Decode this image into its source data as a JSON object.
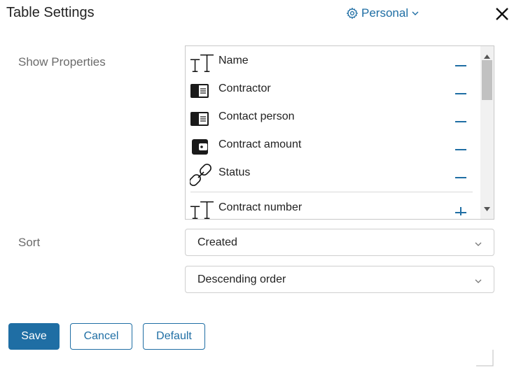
{
  "dialog": {
    "title": "Table Settings",
    "personal_label": "Personal",
    "colors": {
      "accent": "#1f6ea4",
      "label_gray": "#6b6b6b"
    }
  },
  "show_properties": {
    "label": "Show Properties",
    "items": [
      {
        "label": "Name",
        "icon": "text-type-icon",
        "action": "remove"
      },
      {
        "label": "Contractor",
        "icon": "contact-card-icon",
        "action": "remove"
      },
      {
        "label": "Contact person",
        "icon": "contact-card-icon",
        "action": "remove"
      },
      {
        "label": "Contract amount",
        "icon": "wallet-icon",
        "action": "remove"
      },
      {
        "label": "Status",
        "icon": "link-icon",
        "action": "remove"
      },
      {
        "label": "Contract number",
        "icon": "text-type-icon",
        "action": "add"
      }
    ]
  },
  "sort": {
    "label": "Sort",
    "field_value": "Created",
    "order_value": "Descending order"
  },
  "buttons": {
    "save": "Save",
    "cancel": "Cancel",
    "default": "Default"
  }
}
